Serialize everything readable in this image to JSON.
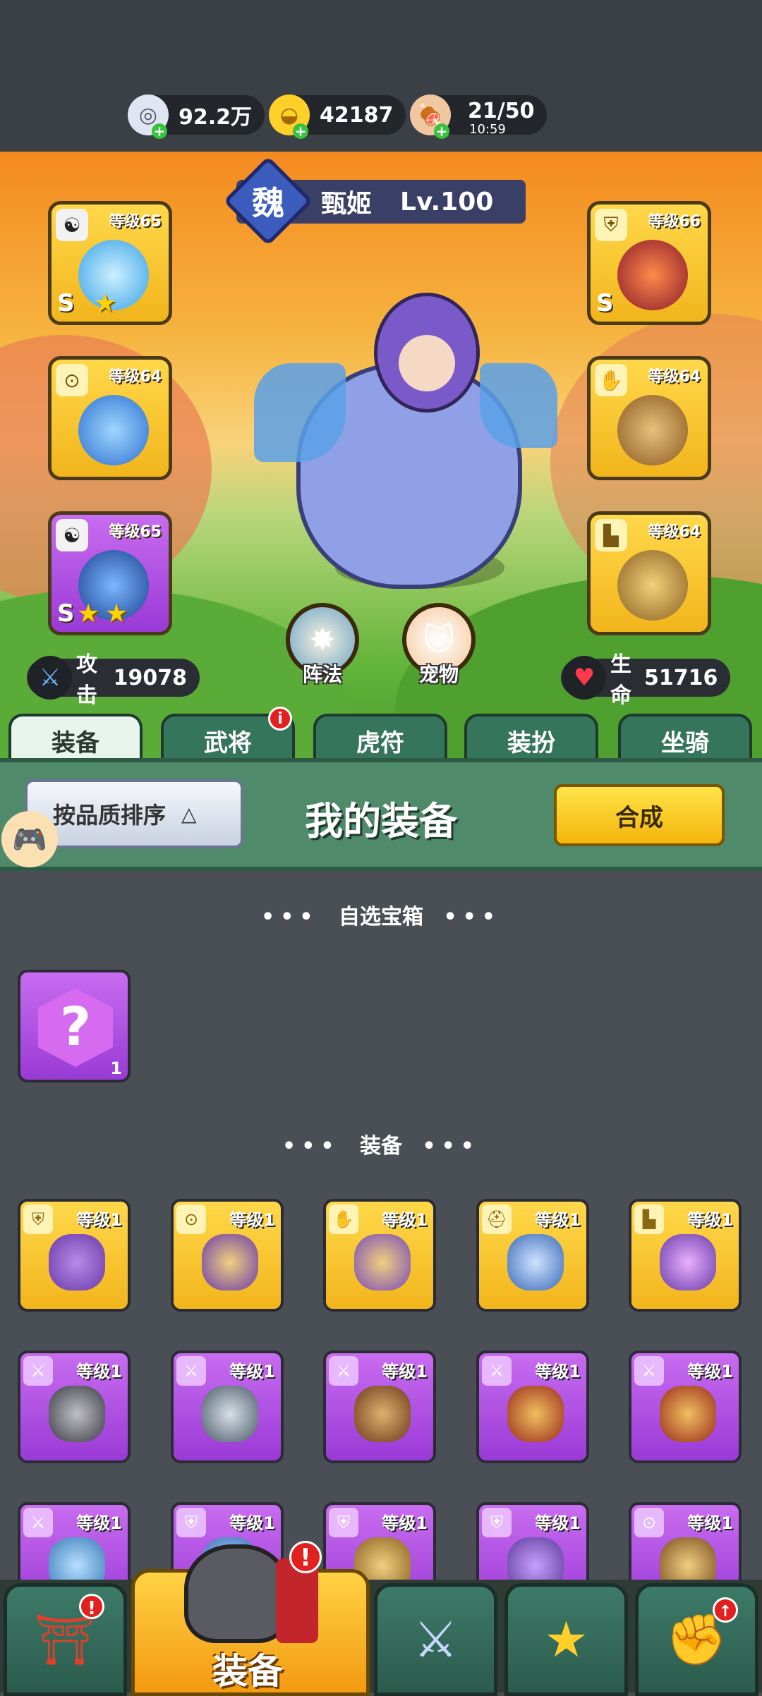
{
  "resources": [
    {
      "icon": "silver-coin-icon",
      "value": "92.2万"
    },
    {
      "icon": "gold-ingot-icon",
      "value": "42187"
    },
    {
      "icon": "meat-icon",
      "value": "21/50",
      "timer": "10:59"
    }
  ],
  "hero": {
    "faction": "魏",
    "name": "甄姬",
    "level": "Lv.100",
    "attack_label": "攻击",
    "attack": "19078",
    "hp_label": "生命",
    "hp": "51716"
  },
  "slots": {
    "weapon": {
      "level": "等级65",
      "grade": "S",
      "stars": 1
    },
    "amulet": {
      "level": "等级64"
    },
    "helmet": {
      "level": "等级65",
      "grade": "S",
      "stars": 2
    },
    "armor": {
      "level": "等级66",
      "grade": "S"
    },
    "gauntlet": {
      "level": "等级64"
    },
    "boots": {
      "level": "等级64"
    }
  },
  "center_buttons": {
    "formation": "阵法",
    "pet": "宠物"
  },
  "tabs": [
    "装备",
    "武将",
    "虎符",
    "装扮",
    "坐骑"
  ],
  "panel": {
    "sort_label": "按品质排序",
    "title": "我的装备",
    "combine": "合成"
  },
  "sections": {
    "chest_title": "自选宝箱",
    "chest_count": "1",
    "equip_title": "装备"
  },
  "items_row1": [
    "等级1",
    "等级1",
    "等级1",
    "等级1",
    "等级1"
  ],
  "items_row2": [
    "等级1",
    "等级1",
    "等级1",
    "等级1",
    "等级1"
  ],
  "items_row3": [
    "等级1",
    "等级1",
    "等级1",
    "等级1",
    "等级1"
  ],
  "bottom_nav": {
    "equip_label": "装备"
  },
  "colors": {
    "gold": "#f2b51c",
    "purple": "#9a3ad6",
    "green_panel": "#4f8a6a"
  }
}
